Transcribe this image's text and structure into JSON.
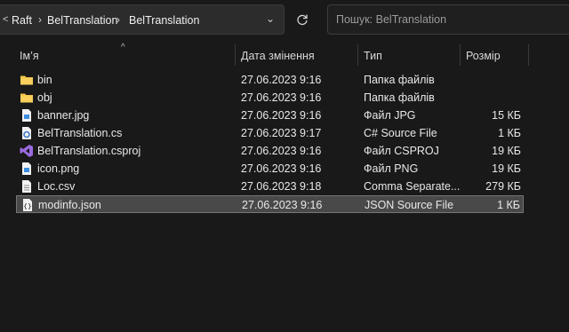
{
  "breadcrumb": {
    "back_glyph": "<",
    "items": [
      "Raft",
      "BelTranslation",
      "BelTranslation"
    ]
  },
  "search": {
    "placeholder": "Пошук: BelTranslation"
  },
  "columns": {
    "name": "Ім’я",
    "modified": "Дата змінення",
    "type": "Тип",
    "size": "Розмір"
  },
  "files": [
    {
      "name": "bin",
      "modified": "27.06.2023 9:16",
      "type": "Папка файлів",
      "size": "",
      "icon": "folder-icon"
    },
    {
      "name": "obj",
      "modified": "27.06.2023 9:16",
      "type": "Папка файлів",
      "size": "",
      "icon": "folder-icon"
    },
    {
      "name": "banner.jpg",
      "modified": "27.06.2023 9:16",
      "type": "Файл JPG",
      "size": "15 КБ",
      "icon": "image-file-icon"
    },
    {
      "name": "BelTranslation.cs",
      "modified": "27.06.2023 9:17",
      "type": "C# Source File",
      "size": "1 КБ",
      "icon": "csharp-file-icon"
    },
    {
      "name": "BelTranslation.csproj",
      "modified": "27.06.2023 9:16",
      "type": "Файл CSPROJ",
      "size": "19 КБ",
      "icon": "visual-studio-icon"
    },
    {
      "name": "icon.png",
      "modified": "27.06.2023 9:16",
      "type": "Файл PNG",
      "size": "19 КБ",
      "icon": "image-file-icon"
    },
    {
      "name": "Loc.csv",
      "modified": "27.06.2023 9:18",
      "type": "Comma Separate...",
      "size": "279 КБ",
      "icon": "document-icon"
    },
    {
      "name": "modinfo.json",
      "modified": "27.06.2023 9:16",
      "type": "JSON Source File",
      "size": "1 КБ",
      "icon": "json-file-icon",
      "selected": true
    }
  ],
  "colors": {
    "background": "#191919",
    "folder": "#f4c54a",
    "selection": "#494949",
    "visual_studio": "#9b6bdf"
  }
}
